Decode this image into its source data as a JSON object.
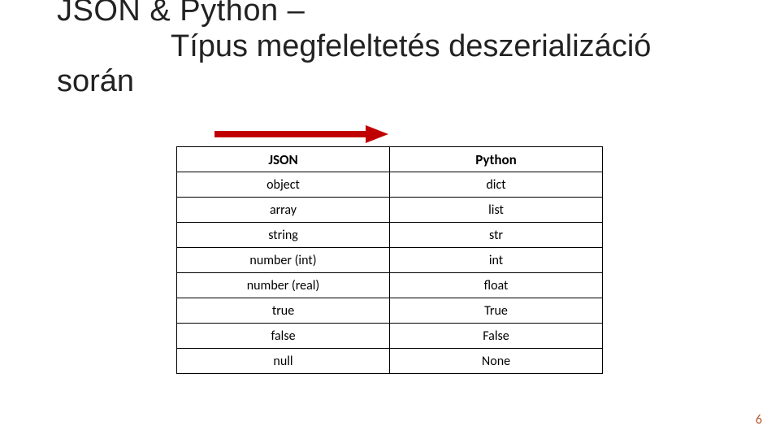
{
  "title": {
    "line1": "JSON & Python –",
    "line2": "Típus megfeleltetés deszerializáció",
    "line3": "során"
  },
  "table": {
    "headers": {
      "col1": "JSON",
      "col2": "Python"
    },
    "rows": [
      {
        "json": "object",
        "python": "dict"
      },
      {
        "json": "array",
        "python": "list"
      },
      {
        "json": "string",
        "python": "str"
      },
      {
        "json": "number (int)",
        "python": "int"
      },
      {
        "json": "number (real)",
        "python": "float"
      },
      {
        "json": "true",
        "python": "True"
      },
      {
        "json": "false",
        "python": "False"
      },
      {
        "json": "null",
        "python": "None"
      }
    ]
  },
  "page_number": "6",
  "arrow": {
    "color": "#c00000"
  }
}
